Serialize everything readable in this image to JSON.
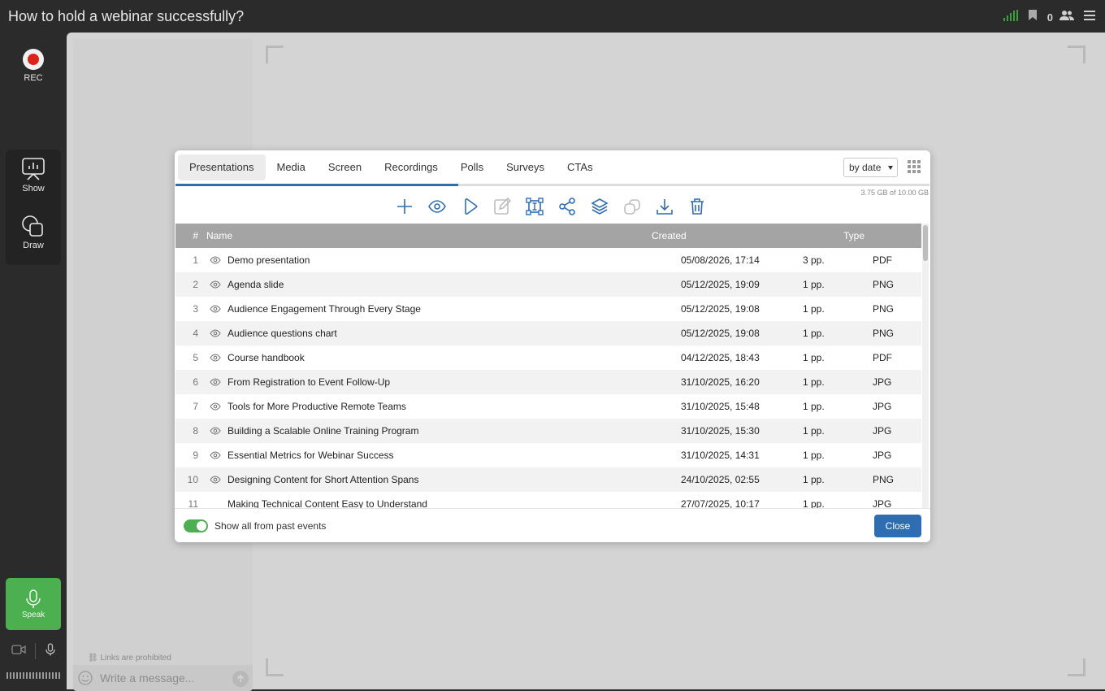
{
  "header": {
    "title": "How to hold a webinar successfully?",
    "participant_count": "0",
    "icons": [
      "signal-icon",
      "bookmark-icon",
      "participants-icon",
      "menu-icon"
    ]
  },
  "rail": {
    "rec_label": "REC",
    "show_label": "Show",
    "draw_label": "Draw",
    "speak_label": "Speak"
  },
  "chat": {
    "links_note": "Links are prohibited",
    "placeholder": "Write a message..."
  },
  "modal": {
    "tabs": [
      {
        "label": "Presentations",
        "active": true
      },
      {
        "label": "Media"
      },
      {
        "label": "Screen"
      },
      {
        "label": "Recordings"
      },
      {
        "label": "Polls"
      },
      {
        "label": "Surveys"
      },
      {
        "label": "CTAs"
      }
    ],
    "sort_value": "by date",
    "storage_text": "3.75 GB of 10.00 GB",
    "storage_used_fraction": 0.375,
    "toolbar_icons": [
      "add-icon",
      "preview-icon",
      "play-icon",
      "edit-icon",
      "resize-icon",
      "share-icon",
      "layers-icon",
      "duplicate-icon",
      "download-icon",
      "delete-icon"
    ],
    "columns": {
      "num": "#",
      "name": "Name",
      "created": "Created",
      "pages": "",
      "type": "Type"
    },
    "rows": [
      {
        "num": "1",
        "name": "Demo presentation",
        "created": "05/08/2026, 17:14",
        "pages": "3 pp.",
        "type": "PDF"
      },
      {
        "num": "2",
        "name": "Agenda slide",
        "created": "05/12/2025, 19:09",
        "pages": "1 pp.",
        "type": "PNG"
      },
      {
        "num": "3",
        "name": "Audience Engagement Through Every Stage",
        "created": "05/12/2025, 19:08",
        "pages": "1 pp.",
        "type": "PNG"
      },
      {
        "num": "4",
        "name": "Audience questions chart",
        "created": "05/12/2025, 19:08",
        "pages": "1 pp.",
        "type": "PNG"
      },
      {
        "num": "5",
        "name": "Course handbook",
        "created": "04/12/2025, 18:43",
        "pages": "1 pp.",
        "type": "PDF"
      },
      {
        "num": "6",
        "name": "From Registration to Event Follow-Up",
        "created": "31/10/2025, 16:20",
        "pages": "1 pp.",
        "type": "JPG"
      },
      {
        "num": "7",
        "name": "Tools for More Productive Remote Teams",
        "created": "31/10/2025, 15:48",
        "pages": "1 pp.",
        "type": "JPG"
      },
      {
        "num": "8",
        "name": "Building a Scalable Online Training Program",
        "created": "31/10/2025, 15:30",
        "pages": "1 pp.",
        "type": "JPG"
      },
      {
        "num": "9",
        "name": "Essential Metrics for Webinar Success",
        "created": "31/10/2025, 14:31",
        "pages": "1 pp.",
        "type": "JPG"
      },
      {
        "num": "10",
        "name": "Designing Content for Short Attention Spans",
        "created": "24/10/2025, 02:55",
        "pages": "1 pp.",
        "type": "PNG"
      },
      {
        "num": "11",
        "name": "Making Technical Content Easy to Understand",
        "created": "27/07/2025, 10:17",
        "pages": "1 pp.",
        "type": "JPG"
      }
    ],
    "toggle_label": "Show all from past events",
    "toggle_on": true,
    "close_label": "Close"
  }
}
